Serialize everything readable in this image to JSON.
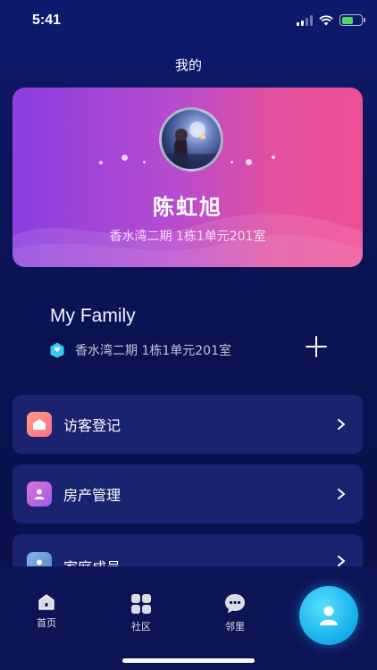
{
  "status_bar": {
    "time": "5:41"
  },
  "header": {
    "title": "我的"
  },
  "profile": {
    "name": "陈虹旭",
    "address": "香水湾二期 1栋1单元201室"
  },
  "family": {
    "title": "My Family",
    "address": "香水湾二期 1栋1单元201室"
  },
  "menu": [
    {
      "label": "访客登记",
      "icon": "visitor-icon",
      "color": "#ff7e8b"
    },
    {
      "label": "房产管理",
      "icon": "property-icon",
      "color": "#c56be0"
    },
    {
      "label": "家庭成员",
      "icon": "family-member-icon",
      "color": "#6a9fd8"
    }
  ],
  "tabbar": {
    "tabs": [
      {
        "label": "首页",
        "icon": "home-icon"
      },
      {
        "label": "社区",
        "icon": "community-grid-icon"
      },
      {
        "label": "邻里",
        "icon": "chat-bubble-icon"
      }
    ],
    "fab_icon": "user-icon"
  },
  "colors": {
    "accent": "#1cb4ee",
    "card_start": "#8a3fe0",
    "card_end": "#ef4e95"
  }
}
